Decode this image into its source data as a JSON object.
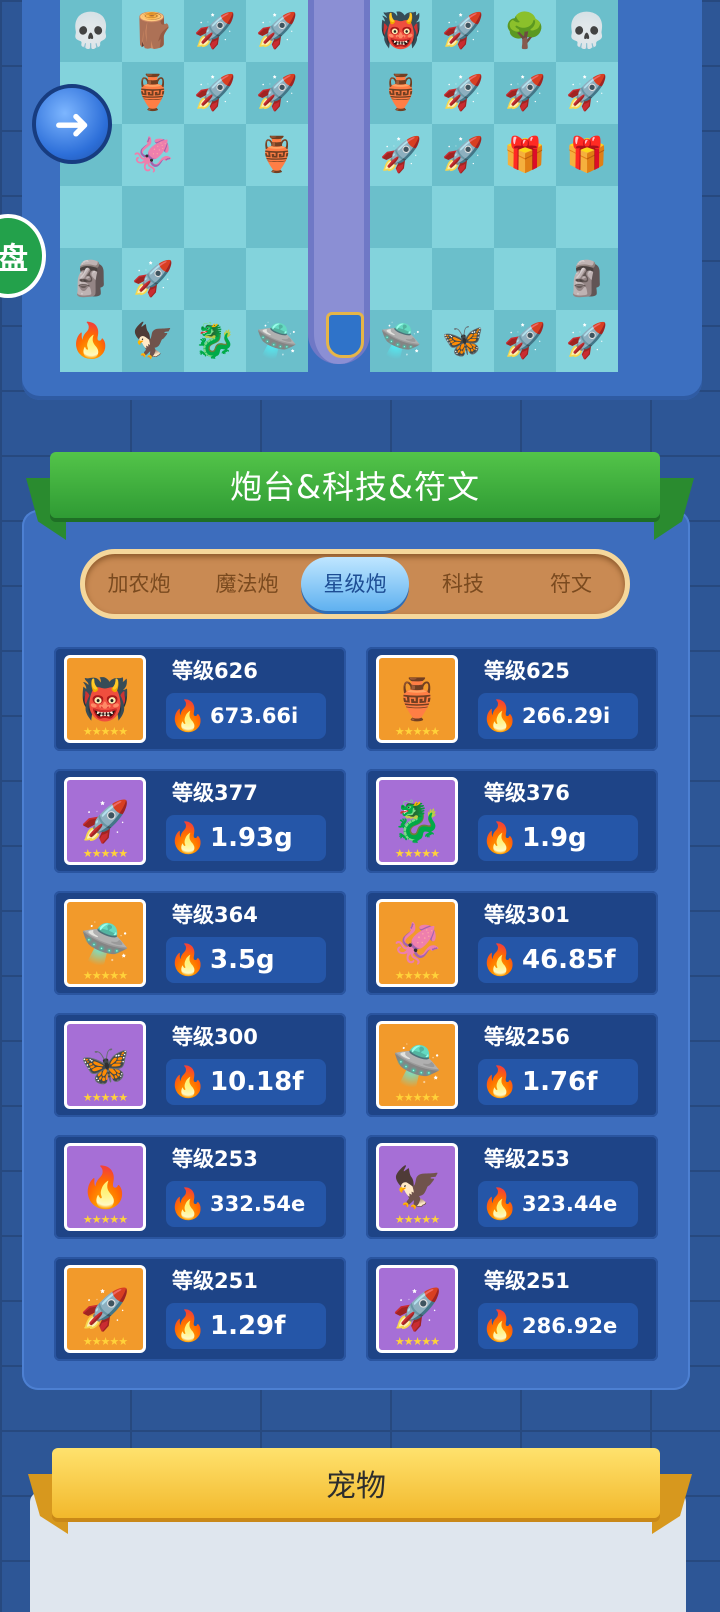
{
  "board": {
    "left_half": [
      [
        "💀",
        "🪵",
        "🚀",
        "🚀"
      ],
      [
        "",
        "🏺",
        "🚀",
        "🚀"
      ],
      [
        "",
        "🦑",
        "",
        "🏺"
      ],
      [
        "",
        "",
        "",
        ""
      ],
      [
        "🗿",
        "🚀",
        "",
        ""
      ],
      [
        "🔥",
        "🦅",
        "🐉",
        "🛸"
      ]
    ],
    "right_half": [
      [
        "👹",
        "🚀",
        "🌳",
        "💀"
      ],
      [
        "🏺",
        "🚀",
        "🚀",
        "🚀"
      ],
      [
        "🚀",
        "🚀",
        "🎁",
        "🎁"
      ],
      [
        "",
        "",
        "",
        ""
      ],
      [
        "",
        "",
        "",
        "🗿"
      ],
      [
        "🛸",
        "🦋",
        "🚀",
        "🚀"
      ]
    ]
  },
  "side_button_label": "盘",
  "back_icon": "arrow-left",
  "section": {
    "title": "炮台&科技&符文",
    "tabs": [
      {
        "label": "加农炮",
        "active": false
      },
      {
        "label": "魔法炮",
        "active": false
      },
      {
        "label": "星级炮",
        "active": true
      },
      {
        "label": "科技",
        "active": false
      },
      {
        "label": "符文",
        "active": false
      }
    ],
    "turrets": [
      {
        "level": "等级626",
        "power": "673.66i",
        "icon": "👹",
        "bg": "orange"
      },
      {
        "level": "等级625",
        "power": "266.29i",
        "icon": "🏺",
        "bg": "orange"
      },
      {
        "level": "等级377",
        "power": "1.93g",
        "icon": "🚀",
        "bg": "purple"
      },
      {
        "level": "等级376",
        "power": "1.9g",
        "icon": "🐉",
        "bg": "purple"
      },
      {
        "level": "等级364",
        "power": "3.5g",
        "icon": "🛸",
        "bg": "orange"
      },
      {
        "level": "等级301",
        "power": "46.85f",
        "icon": "🦑",
        "bg": "orange"
      },
      {
        "level": "等级300",
        "power": "10.18f",
        "icon": "🦋",
        "bg": "purple"
      },
      {
        "level": "等级256",
        "power": "1.76f",
        "icon": "🛸",
        "bg": "orange"
      },
      {
        "level": "等级253",
        "power": "332.54e",
        "icon": "🔥",
        "bg": "purple"
      },
      {
        "level": "等级253",
        "power": "323.44e",
        "icon": "🦅",
        "bg": "purple"
      },
      {
        "level": "等级251",
        "power": "1.29f",
        "icon": "🚀",
        "bg": "orange"
      },
      {
        "level": "等级251",
        "power": "286.92e",
        "icon": "🚀",
        "bg": "purple"
      }
    ]
  },
  "pet": {
    "title": "宠物"
  }
}
